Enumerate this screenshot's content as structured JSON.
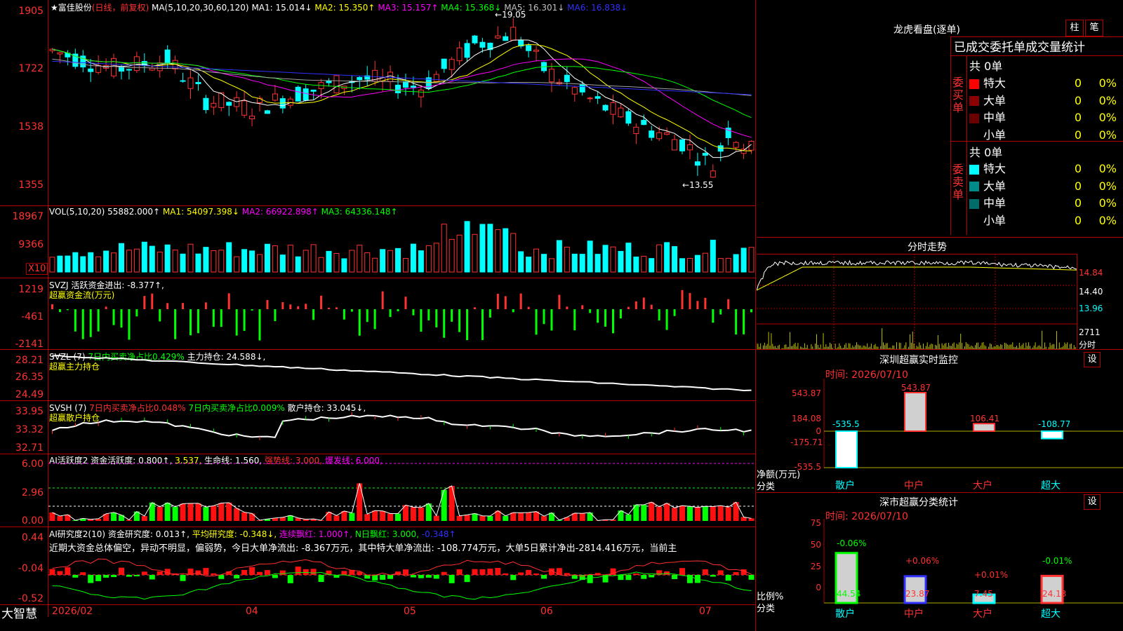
{
  "header": {
    "stock_name": "富佳股份",
    "period": "(日线，前复权)",
    "ma_label": "MA(5,10,20,30,60,120)",
    "ma": [
      {
        "label": "MA1: 15.014↓",
        "color": "#ffffff"
      },
      {
        "label": "MA2: 15.350↑",
        "color": "#ffff00"
      },
      {
        "label": "MA3: 15.157↑",
        "color": "#ff00ff"
      },
      {
        "label": "MA4: 15.368↓",
        "color": "#00ff00"
      },
      {
        "label": "MA5: 16.301↓",
        "color": "#c0c0c0"
      },
      {
        "label": "MA6: 16.838↓",
        "color": "#3030ff"
      }
    ],
    "high_marker": "19.05",
    "low_marker": "13.55"
  },
  "price_axis": [
    "1905",
    "1722",
    "1538",
    "1355"
  ],
  "volume": {
    "label": "VOL(5,10,20)",
    "value": "55882.000↑",
    "ma": [
      {
        "label": "MA1: 54097.398↓",
        "color": "#ffff00"
      },
      {
        "label": "MA2: 66922.898↑",
        "color": "#ff00ff"
      },
      {
        "label": "MA3: 64336.148↑",
        "color": "#00ff00"
      }
    ],
    "axis": [
      "18967",
      "9366"
    ],
    "unit": "X10"
  },
  "svzj": {
    "label": "SVZJ",
    "desc": "活跃资金进出: -8.377↑,",
    "sub": "超赢资金流(万元)",
    "axis": [
      "1219",
      "-461",
      "-2141"
    ]
  },
  "svzl": {
    "label": "SVZL (7)",
    "desc1": "7日内买卖净占比0.429%",
    "desc2": "主力持仓: 24.588↓,",
    "sub": "超赢主力持仓",
    "axis": [
      "28.21",
      "26.35",
      "24.49"
    ]
  },
  "svsh": {
    "label": "SVSH (7)",
    "desc1": "7日内买卖净占比0.048%",
    "desc2": "7日内买卖净占比0.009%",
    "desc3": "散户持仓: 33.045↓,",
    "sub": "超赢散户持仓",
    "axis": [
      "33.95",
      "33.32",
      "32.71"
    ]
  },
  "ai_activity": {
    "label": "AI活跃度2",
    "d1": "资金活跃度: 0.800↑,",
    "d2": "3.537,",
    "d3": "生命线: 1.560,",
    "d4": "强势线: 3.000,",
    "d5": "爆发线: 6.000,",
    "axis": [
      "6.00",
      "2.96",
      "0.00"
    ]
  },
  "ai_research": {
    "label": "AI研究度2(10)",
    "d1": "资金研究度: 0.013↑,",
    "d2": "平均研究度: -0.348↓,",
    "d3": "连续飘红: 1.000↑,",
    "d4": "N日飘红: 3.000,",
    "d5": "-0.348↑",
    "comment": "近期大资金总体偏空，异动不明显，偏弱势，今日大单净流出: -8.367万元，其中特大单净流出: -108.774万元，大单5日累计净出-2814.416万元，当前主",
    "axis": [
      "0.44",
      "-0.04",
      "-0.52"
    ]
  },
  "date_axis": [
    "2026/02",
    "04",
    "05",
    "06",
    "07"
  ],
  "brand": "大智慧",
  "right": {
    "dragon_title": "龙虎看盘(逐单)",
    "btn_zhu": "柱",
    "btn_bi": "笔",
    "table_title": "已成交委托单成交量统计",
    "buy_group": "委买单",
    "sell_group": "委卖单",
    "buy_total": "共 0单",
    "sell_total": "共 0单",
    "rows": [
      {
        "name": "特大",
        "count": "0",
        "pct": "0%"
      },
      {
        "name": "大单",
        "count": "0",
        "pct": "0%"
      },
      {
        "name": "中单",
        "count": "0",
        "pct": "0%"
      },
      {
        "name": "小单",
        "count": "0",
        "pct": "0%"
      }
    ],
    "buy_colors": [
      "#ff0000",
      "#8b0000",
      "#6b0000",
      "#000000"
    ],
    "sell_colors": [
      "#00ffff",
      "#008b8b",
      "#006b6b",
      "#000000"
    ],
    "intraday_title": "分时走势",
    "intraday_axis": [
      "14.84",
      "14.40",
      "13.96"
    ],
    "intraday_vol": "2711",
    "intraday_unit": "分时",
    "sz_title": "深圳超赢实时监控",
    "setting": "设",
    "time1": "时间: 2026/07/10",
    "sz_axis": [
      "543.87",
      "184.08",
      "0",
      "-175.71",
      "-535.5"
    ],
    "sz_values": [
      "-535.5",
      "543.87",
      "106.41",
      "-108.77"
    ],
    "cats": [
      "散户",
      "中户",
      "大户",
      "超大"
    ],
    "sz_ylabel": "净额(万元)",
    "sz_xlabel": "分类",
    "cls_title": "深市超赢分类统计",
    "time2": "时间: 2026/07/10",
    "cls_axis": [
      "75",
      "50",
      "25",
      "0"
    ],
    "cls_top": [
      "-0.06%",
      "+0.06%",
      "+0.01%",
      "-0.01%"
    ],
    "cls_bottom": [
      "44.54",
      "23.87",
      "7.45",
      "24.13"
    ],
    "cls_ylabel": "比例%",
    "cls_xlabel": "分类"
  },
  "chart_data": [
    {
      "type": "bar",
      "title": "深圳超赢实时监控",
      "categories": [
        "散户",
        "中户",
        "大户",
        "超大"
      ],
      "values": [
        -535.5,
        543.87,
        106.41,
        -108.77
      ],
      "ylabel": "净额(万元)",
      "xlabel": "分类",
      "ylim": [
        -535.5,
        543.87
      ]
    },
    {
      "type": "bar",
      "title": "深市超赢分类统计",
      "categories": [
        "散户",
        "中户",
        "大户",
        "超大"
      ],
      "values": [
        44.54,
        23.87,
        7.45,
        24.13
      ],
      "ylabel": "比例%",
      "xlabel": "分类",
      "ylim": [
        0,
        75
      ]
    }
  ]
}
